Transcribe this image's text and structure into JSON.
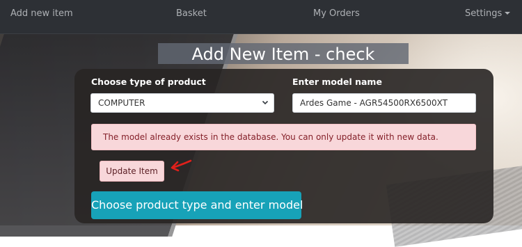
{
  "navbar": {
    "items": [
      "Add new item",
      "Basket",
      "My Orders"
    ],
    "settings_label": "Settings"
  },
  "page": {
    "title": "Add New Item - check"
  },
  "form": {
    "product_type_label": "Choose type of product",
    "product_type_value": "COMPUTER",
    "model_label": "Enter model name",
    "model_value": "Ardes Game - AGR54500RX6500XT",
    "alert_text": "The model already exists in the database. You can only update it with new data.",
    "update_button": "Update Item",
    "submit_button": "Choose product type and enter model"
  },
  "colors": {
    "navbar_bg": "#2d3035",
    "alert_bg": "#f8d7da",
    "alert_text": "#842029",
    "primary": "#17a2b8",
    "annotation_arrow": "#e0201b"
  }
}
